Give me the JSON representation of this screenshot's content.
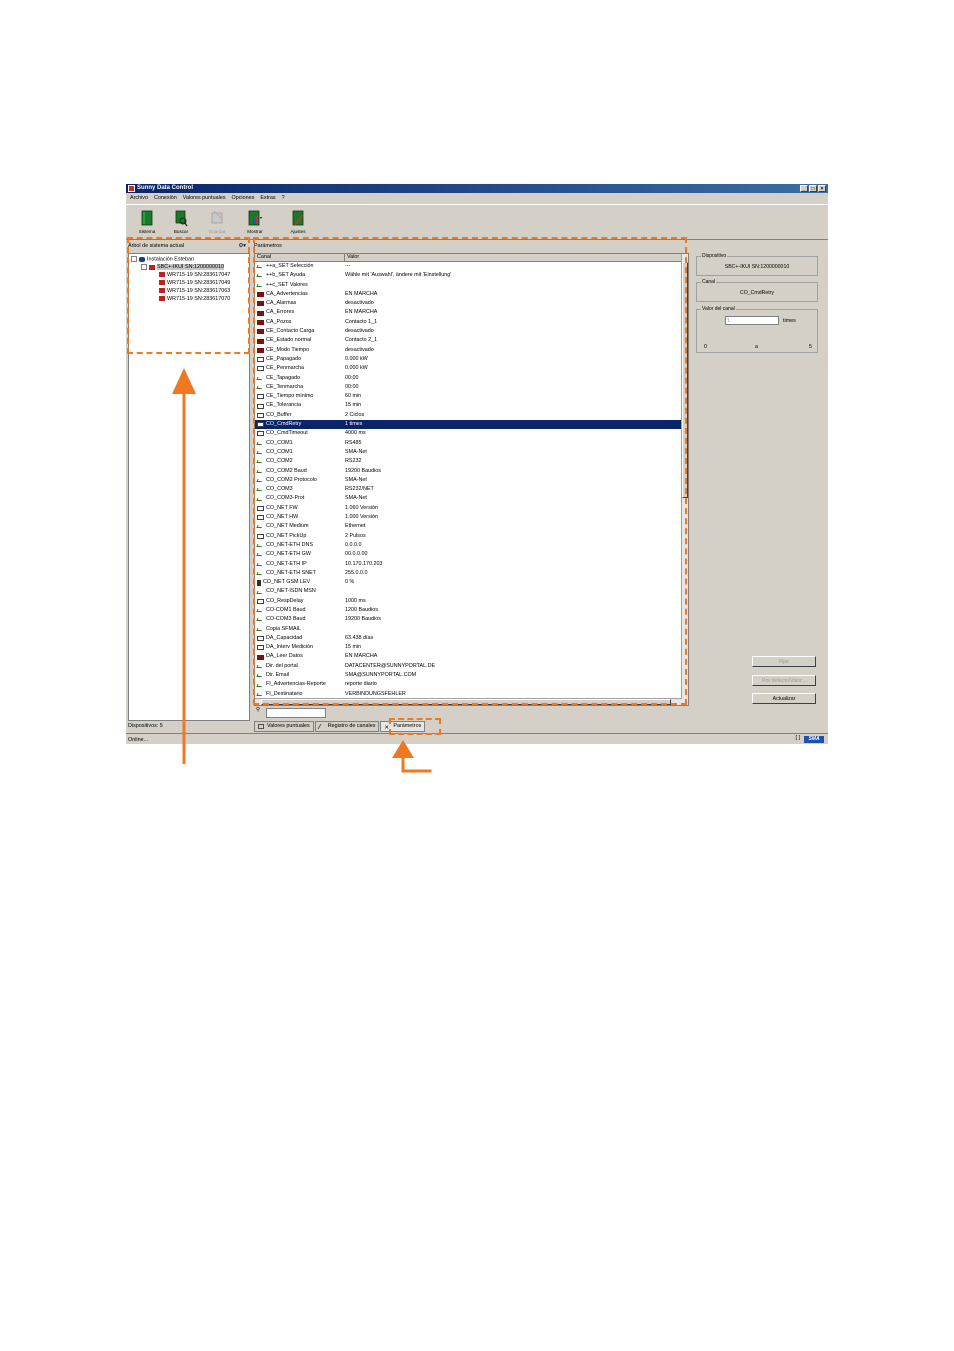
{
  "window": {
    "title": "Sunny Data Control"
  },
  "menu": [
    "Archivo",
    "Conexión",
    "Valores puntuales",
    "Opciones",
    "Extras",
    "?"
  ],
  "toolbar": [
    {
      "label": "Sistema",
      "enabled": true
    },
    {
      "label": "Buscar",
      "enabled": true
    },
    {
      "label": "Guardar",
      "enabled": false
    },
    {
      "label": "Mostrar",
      "enabled": true
    },
    {
      "label": "Ajustes",
      "enabled": true
    }
  ],
  "left": {
    "header": "Árbol de sistema actual",
    "tree": [
      {
        "label": "Instalación Esteban",
        "level": 0
      },
      {
        "label": "SBC+-IKUI SN:1200000010",
        "level": 1
      },
      {
        "label": "WR715-19 SN:283617047",
        "level": 2
      },
      {
        "label": "WR715-19 SN:283617049",
        "level": 2
      },
      {
        "label": "WR715-19 SN:283617063",
        "level": 2
      },
      {
        "label": "WR715-19 SN:283617070",
        "level": 2
      }
    ],
    "footer": "Dispositivos: 5"
  },
  "center": {
    "header": "Parámetros",
    "columns": [
      "Canal",
      "Valor"
    ],
    "rows": [
      {
        "canal": "++a_SET Selección",
        "valor": "---",
        "icon": "check"
      },
      {
        "canal": "++b_SET Ayuda",
        "valor": "Wähle mit 'Auswahl', ändere mit 'Einstellung'",
        "icon": "check"
      },
      {
        "canal": "++c_SET Valores",
        "valor": "",
        "icon": "check"
      },
      {
        "canal": "CA_Advertencias",
        "valor": "EN MARCHA",
        "icon": "red"
      },
      {
        "canal": "CA_Alarmas",
        "valor": "desactivado",
        "icon": "red"
      },
      {
        "canal": "CA_Errores",
        "valor": "EN MARCHA",
        "icon": "red"
      },
      {
        "canal": "CA_Pozos",
        "valor": "Contacto 1_1",
        "icon": "red"
      },
      {
        "canal": "CE_Contacto Carga",
        "valor": "desactivado",
        "icon": "red"
      },
      {
        "canal": "CE_Estado normal",
        "valor": "Contacto 2_1",
        "icon": "red"
      },
      {
        "canal": "CE_Modo Tiempo",
        "valor": "desactivado",
        "icon": "red"
      },
      {
        "canal": "CE_Papagado",
        "valor": "0.000 kW",
        "icon": "box"
      },
      {
        "canal": "CE_Penmarcha",
        "valor": "0.000 kW",
        "icon": "box"
      },
      {
        "canal": "CE_Tapagado",
        "valor": "00:00",
        "icon": "check"
      },
      {
        "canal": "CE_Tenmarcha",
        "valor": "00:00",
        "icon": "check"
      },
      {
        "canal": "CE_Tiempo mínimo",
        "valor": "60 min",
        "icon": "box"
      },
      {
        "canal": "CE_Tolerancia",
        "valor": "15 min",
        "icon": "box"
      },
      {
        "canal": "CO_Buffer",
        "valor": "2 Ciclos",
        "icon": "box"
      },
      {
        "canal": "CO_CmdRetry",
        "valor": "1 times",
        "icon": "box",
        "selected": true
      },
      {
        "canal": "CO_CmdTimeout",
        "valor": "4000 ms",
        "icon": "box"
      },
      {
        "canal": "CO_COM1",
        "valor": "RS485",
        "icon": "check"
      },
      {
        "canal": "CO_COM1",
        "valor": "SMA-Net",
        "icon": "check"
      },
      {
        "canal": "CO_COM2",
        "valor": "RS232",
        "icon": "check"
      },
      {
        "canal": "CO_COM2 Baud",
        "valor": "19200 Baudios",
        "icon": "check"
      },
      {
        "canal": "CO_COM2 Protocolo",
        "valor": "SMA-Net",
        "icon": "check"
      },
      {
        "canal": "CO_COM3",
        "valor": "RS232/NET",
        "icon": "check"
      },
      {
        "canal": "CO_COM3-Prot",
        "valor": "SMA-Net",
        "icon": "check"
      },
      {
        "canal": "CO_NET FW",
        "valor": "1.060 Versión",
        "icon": "box"
      },
      {
        "canal": "CO_NET HW",
        "valor": "1.000 Versión",
        "icon": "box"
      },
      {
        "canal": "CO_NET Medium",
        "valor": "Ethernet",
        "icon": "check"
      },
      {
        "canal": "CO_NET PickUp",
        "valor": "2 Pulsos",
        "icon": "box"
      },
      {
        "canal": "CO_NET-ETH DNS",
        "valor": "0.0.0.0",
        "icon": "check"
      },
      {
        "canal": "CO_NET-ETH GW",
        "valor": "00.0.0.00",
        "icon": "check"
      },
      {
        "canal": "CO_NET-ETH IP",
        "valor": "10.170.170.203",
        "icon": "check"
      },
      {
        "canal": "CO_NET-ETH SNET",
        "valor": "255.0.0.0",
        "icon": "check"
      },
      {
        "canal": "CO_NET GSM LEV",
        "valor": "0 %",
        "icon": "dev"
      },
      {
        "canal": "CO_NET-ISDN MSN",
        "valor": "",
        "icon": "check"
      },
      {
        "canal": "CO_RespDelay",
        "valor": "1000 ms",
        "icon": "box"
      },
      {
        "canal": "CO-COM1 Baud",
        "valor": "1200 Baudios",
        "icon": "check"
      },
      {
        "canal": "CO-COM3 Baud",
        "valor": "19200 Baudios",
        "icon": "check"
      },
      {
        "canal": "Copia SFMAIL",
        "valor": "",
        "icon": "check"
      },
      {
        "canal": "DA_Capacidad",
        "valor": "63.438 días",
        "icon": "box"
      },
      {
        "canal": "DA_Interv Medición",
        "valor": "15 min",
        "icon": "box"
      },
      {
        "canal": "DA_Leer Datos",
        "valor": "EN MARCHA",
        "icon": "red"
      },
      {
        "canal": "Dir. del portal",
        "valor": "DATACENTER@SUNNYPORTAL.DE",
        "icon": "check"
      },
      {
        "canal": "Dir. Email",
        "valor": "SMA@SUNNYPORTAL.COM",
        "icon": "check"
      },
      {
        "canal": "FI_Advertencias-Reporte",
        "valor": "reporte diario",
        "icon": "check"
      },
      {
        "canal": "FI_Destinatario",
        "valor": "VERBINDUNGSFEHLER",
        "icon": "check"
      }
    ]
  },
  "right": {
    "device_label": "Dispositivo",
    "device_value": "SBC+-IKUI SN:1200000010",
    "channel_label": "Canal",
    "channel_value": "CO_CmdRetry",
    "value_label": "Valor del canal",
    "value_input": "1",
    "value_unit": "times",
    "range_min": "0",
    "range_mid": "a",
    "range_max": "5",
    "btn_set": "Fijar",
    "btn_default": "Por defecto/Valor...",
    "btn_update": "Actualizar"
  },
  "tabs": [
    "Valores puntuales",
    "Registro de canales",
    "Parámetros"
  ],
  "status": {
    "text": "Online..."
  }
}
